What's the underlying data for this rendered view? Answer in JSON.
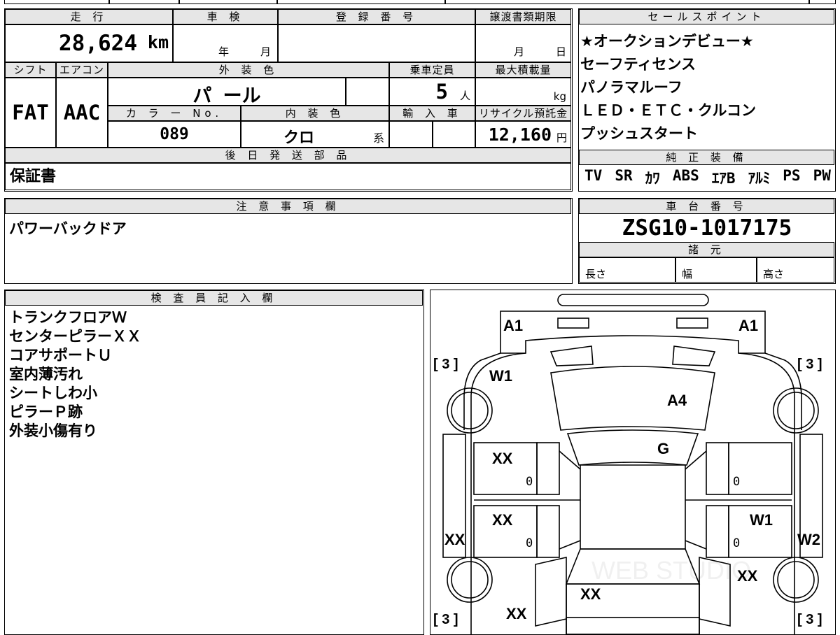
{
  "vehicle": {
    "mileage_header": "走 行",
    "mileage": "28,624",
    "mileage_unit": "km",
    "inspection_header": "車 検",
    "inspection_year_label": "年",
    "inspection_month_label": "月",
    "registration_header": "登 録 番 号",
    "transfer_deadline_header": "譲渡書類期限",
    "transfer_month_label": "月",
    "transfer_day_label": "日",
    "shift_header": "シフト",
    "shift": "FAT",
    "aircon_header": "エアコン",
    "aircon": "AAC",
    "exterior_color_header": "外 装 色",
    "exterior_color": "パ ール",
    "capacity_header": "乗車定員",
    "capacity": "5",
    "capacity_unit": "人",
    "max_load_header": "最大積載量",
    "max_load_unit": "kg",
    "color_no_header": "カ ラ ー No.",
    "color_no": "089",
    "interior_color_header": "内 装 色",
    "interior_color": "クロ",
    "interior_color_suffix": "系",
    "import_header": "輸 入 車",
    "recycle_header": "リサイクル預託金",
    "recycle_fee": "12,160",
    "recycle_unit": "円"
  },
  "later_parts": {
    "header": "後 日 発 送 部 品",
    "value": "保証書"
  },
  "sales_points": {
    "header": "セールスポイント",
    "items": [
      "★オークションデビュー★",
      "セーフティセンス",
      "パノラマルーフ",
      "ＬＥＤ・ＥＴＣ・クルコン",
      "プッシュスタート"
    ]
  },
  "genuine_equipment": {
    "header": "純 正 装 備",
    "items": [
      "TV",
      "SR",
      "ｶﾜ",
      "ABS",
      "ｴｱB",
      "ｱﾙﾐ",
      "PS",
      "PW"
    ]
  },
  "notes": {
    "header": "注 意 事 項 欄",
    "value": "パワーバックドア"
  },
  "chassis": {
    "header": "車 台 番 号",
    "number": "ZSG10-1017175",
    "specs_header": "諸 元",
    "length_label": "長さ",
    "width_label": "幅",
    "height_label": "高さ"
  },
  "inspector": {
    "header": "検 査 員 記 入 欄",
    "lines": [
      "トランクフロアＷ",
      "センターピラーＸＸ",
      "コアサポートＵ",
      "室内薄汚れ",
      "シートしわ小",
      "ピラーＰ跡",
      "外装小傷有り"
    ]
  },
  "diagram": {
    "labels": {
      "a1_left": "A1",
      "a1_right": "A1",
      "w1_front_left": "W1",
      "a4_hood": "A4",
      "g_windshield": "G",
      "xx_door_fl": "XX",
      "xx_door_rl": "XX",
      "xx_side_left": "XX",
      "w1_door_rr": "W1",
      "w2_side_right": "W2",
      "xx_rear_left": "XX",
      "xx_trunk": "XX",
      "xx_rear_right": "XX"
    },
    "tread": {
      "front_left": "3",
      "front_right": "3",
      "rear_left": "3",
      "rear_right": "3"
    },
    "zeros": [
      "0",
      "0",
      "0",
      "0"
    ],
    "watermark": "WEB STUDIO"
  }
}
